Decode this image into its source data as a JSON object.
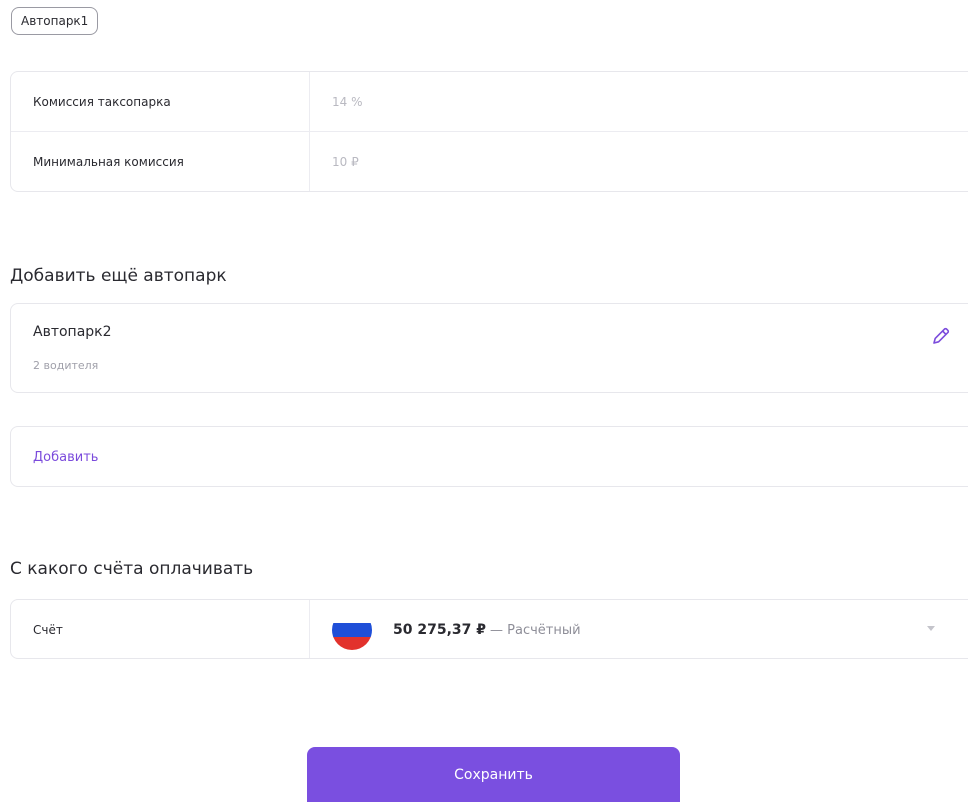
{
  "chip": {
    "label": "Автопарк1"
  },
  "commission": {
    "rows": [
      {
        "label": "Комиссия таксопарка",
        "value": "14 %"
      },
      {
        "label": "Минимальная комиссия",
        "value": "10 ₽"
      }
    ]
  },
  "add_fleet_section": {
    "title": "Добавить ещё автопарк",
    "fleet": {
      "name": "Автопарк2",
      "drivers": "2 водителя",
      "edit_icon": "pencil-icon"
    },
    "add_label": "Добавить"
  },
  "payment_section": {
    "title": "С какого счёта оплачивать",
    "account": {
      "label": "Счёт",
      "amount": "50 275,37 ₽",
      "type": "— Расчётный",
      "flag_icon": "russia-flag-icon",
      "dropdown_icon": "chevron-down-icon"
    }
  },
  "actions": {
    "save_label": "Сохранить"
  },
  "colors": {
    "accent": "#7a4fe0",
    "link": "#7b4bdc",
    "flag_white": "#ffffff",
    "flag_blue": "#1f4fd8",
    "flag_red": "#e2322c"
  }
}
